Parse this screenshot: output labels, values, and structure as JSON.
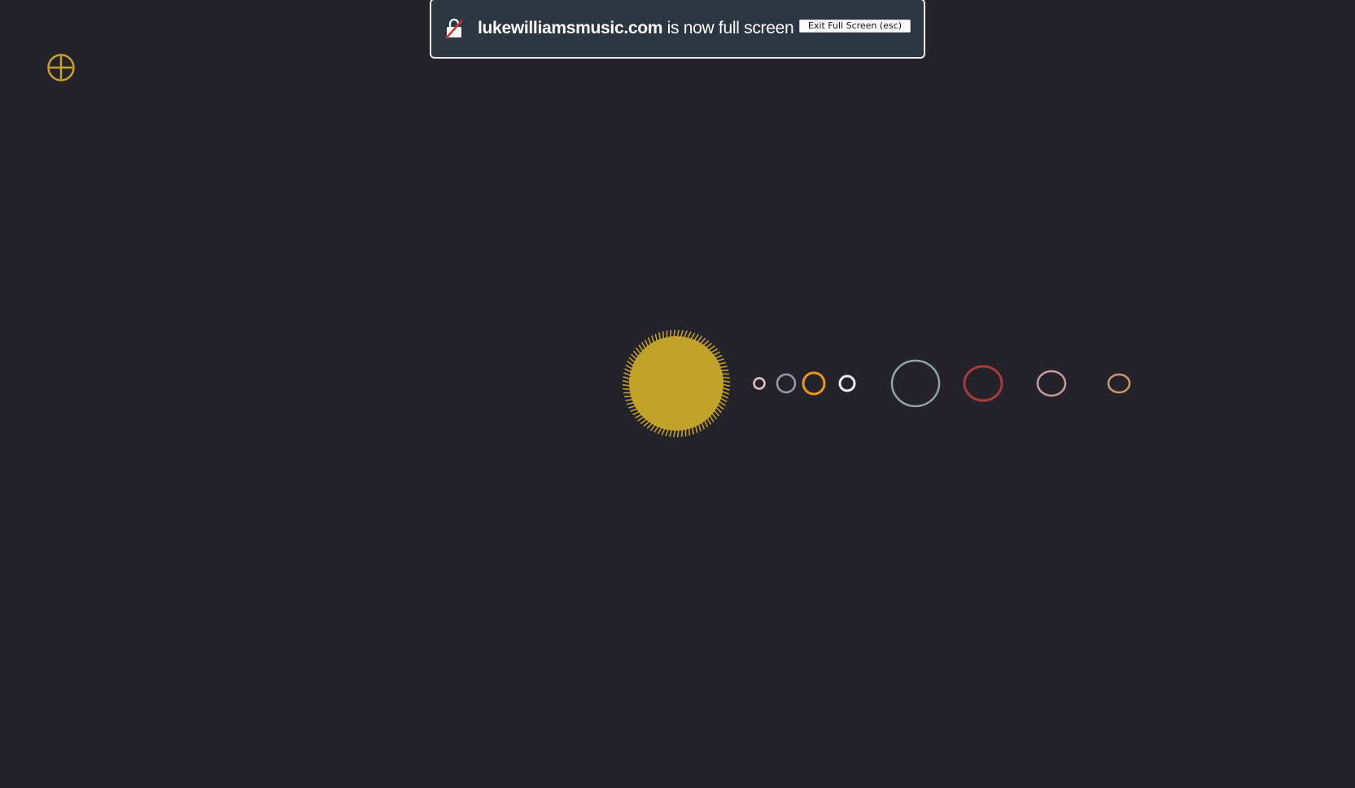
{
  "fullscreen_banner": {
    "domain": "lukewilliamsmusic.com",
    "message": " is now full screen",
    "exit_button_label": "Exit Full Screen (esc)",
    "icon": "no-lock-icon"
  },
  "toolbar": {
    "add_icon": "circle-plus-icon",
    "accent_color": "#c9a22b"
  },
  "solar_system": {
    "background_color": "#24222b",
    "sun": {
      "name": "sun",
      "color": "#c3a22a"
    },
    "planets": [
      {
        "name": "mercury",
        "color": "#e8c4c0"
      },
      {
        "name": "venus",
        "color": "#9b9aa8"
      },
      {
        "name": "earth",
        "color": "#f0941d"
      },
      {
        "name": "mars",
        "color": "#eeeeee"
      },
      {
        "name": "jupiter",
        "color": "#8fa5a7"
      },
      {
        "name": "saturn",
        "color": "#a83a3a"
      },
      {
        "name": "uranus",
        "color": "#c79a9c"
      },
      {
        "name": "neptune",
        "color": "#cf9a62"
      }
    ]
  }
}
